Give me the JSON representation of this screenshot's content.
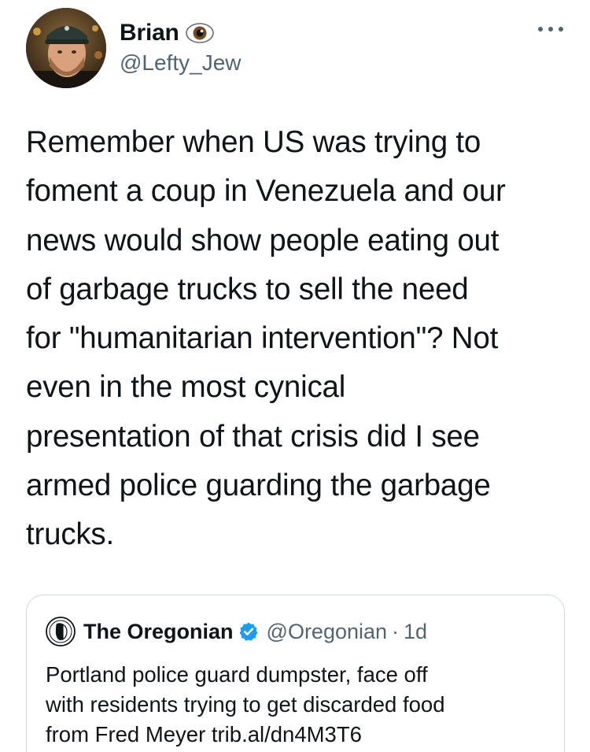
{
  "author": {
    "display_name": "Brian",
    "name_emoji": "eye-emoji",
    "handle": "@Lefty_Jew",
    "avatar": "user-avatar-photo"
  },
  "menu": {
    "icon": "more-options-icon"
  },
  "tweet": {
    "text": "Remember when US was trying to\nfoment a coup in Venezuela and our\nnews would show people eating out\nof garbage trucks to sell the need\nfor \"humanitarian intervention\"? Not\neven in the most cynical\npresentation of that crisis did I see\narmed police guarding the garbage\ntrucks."
  },
  "quoted_tweet": {
    "logo": "oregonian-logo-icon",
    "display_name": "The Oregonian",
    "verified_icon": "verified-badge-icon",
    "handle": "@Oregonian",
    "separator": "·",
    "time": "1d",
    "text": "Portland police guard dumpster, face off\nwith residents trying to get discarded food\nfrom Fred Meyer trib.al/dn4M3T6"
  },
  "colors": {
    "text_primary": "#0f1419",
    "text_secondary": "#536471",
    "verified_blue": "#1d9bf0",
    "card_border": "#cfd9de"
  }
}
